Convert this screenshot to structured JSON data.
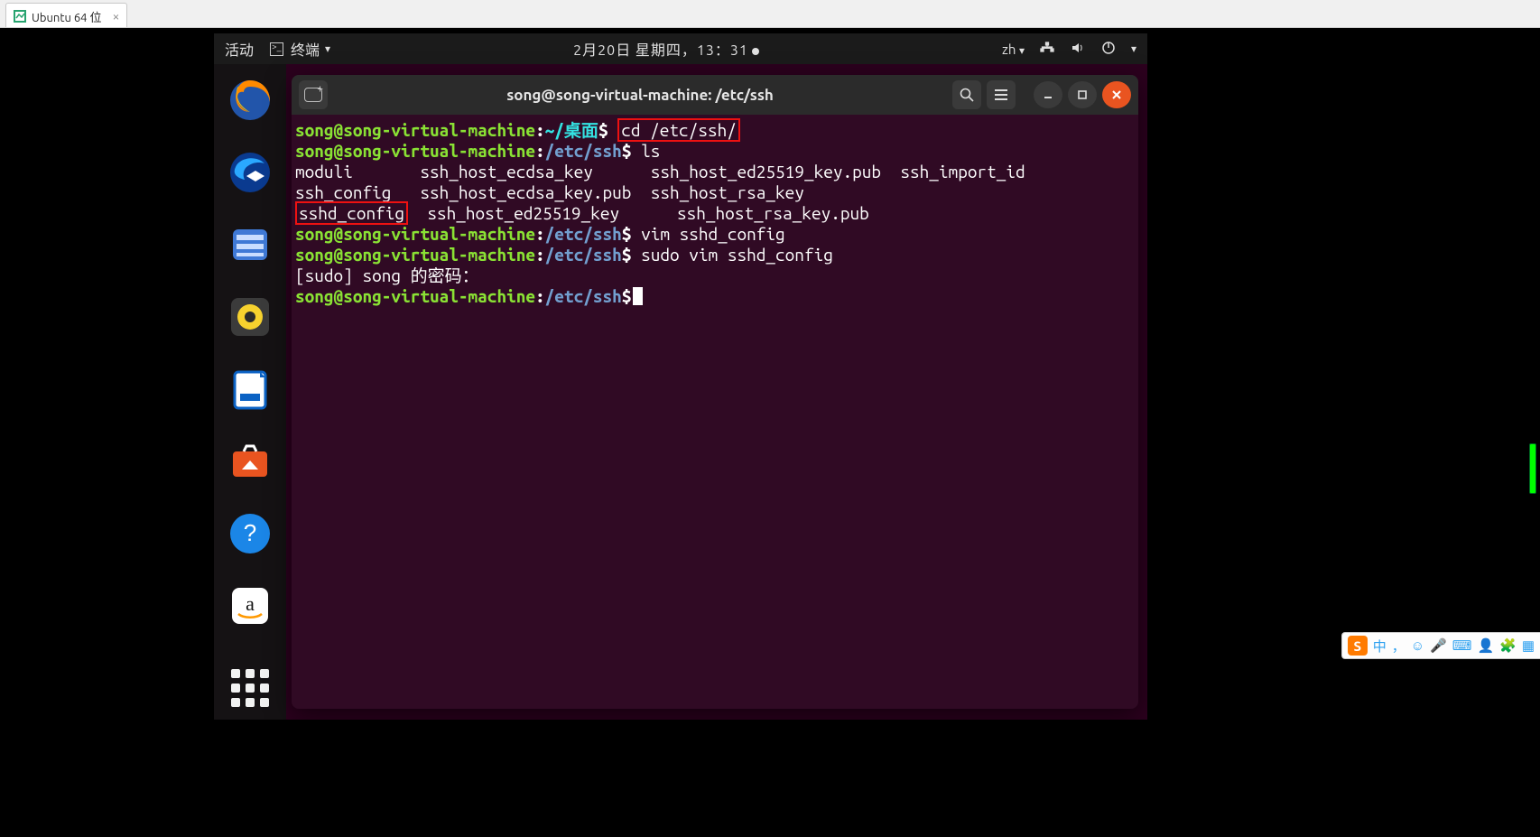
{
  "vm_tab": {
    "label": "Ubuntu 64 位",
    "close": "×"
  },
  "gnome": {
    "activities": "活动",
    "app_menu": "终端",
    "clock": "2月20日 星期四，13：31",
    "lang": "zh"
  },
  "dock_items": [
    "firefox",
    "thunderbird",
    "files",
    "rhythmbox",
    "libreoffice-writer",
    "ubuntu-software",
    "help",
    "amazon"
  ],
  "terminal": {
    "title": "song@song-virtual-machine: /etc/ssh",
    "user_host": "song@song-virtual-machine",
    "home_path": "~/桌面",
    "ssh_path": "/etc/ssh",
    "cmd1": "cd /etc/ssh/",
    "cmd2": "ls",
    "ls": {
      "c1r1": "moduli",
      "c2r1": "ssh_host_ecdsa_key",
      "c3r1": "ssh_host_ed25519_key.pub",
      "c4r1": "ssh_import_id",
      "c1r2": "ssh_config",
      "c2r2": "ssh_host_ecdsa_key.pub",
      "c3r2": "ssh_host_rsa_key",
      "c4r2": "",
      "c1r3": "sshd_config",
      "c2r3": "ssh_host_ed25519_key",
      "c3r3": "ssh_host_rsa_key.pub",
      "c4r3": ""
    },
    "cmd3": "vim sshd_config",
    "cmd4": "sudo vim sshd_config",
    "sudo_prompt": "[sudo] song 的密码："
  },
  "ime": {
    "logo": "S",
    "items": [
      "中",
      "，",
      "☺",
      "🎤",
      "⌨",
      "👤",
      "🧩",
      "▦"
    ]
  }
}
